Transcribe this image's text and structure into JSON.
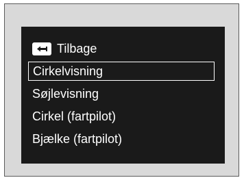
{
  "menu": {
    "back_label": "Tilbage",
    "back_icon": "back-arrow-icon",
    "items": [
      {
        "label": "Cirkelvisning",
        "selected": true
      },
      {
        "label": "Søjlevisning",
        "selected": false
      },
      {
        "label": "Cirkel (fartpilot)",
        "selected": false
      },
      {
        "label": "Bjælke (fartpilot)",
        "selected": false
      }
    ]
  },
  "colors": {
    "frame_bg": "#d9d9d9",
    "screen_bg": "#1a1a1a",
    "text": "#ffffff"
  }
}
